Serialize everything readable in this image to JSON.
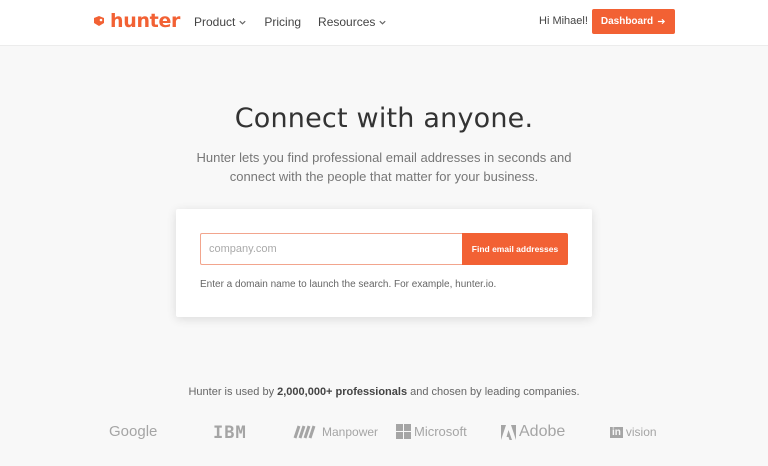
{
  "header": {
    "logo_text": "hunter",
    "nav": [
      {
        "label": "Product",
        "has_dropdown": true
      },
      {
        "label": "Pricing",
        "has_dropdown": false
      },
      {
        "label": "Resources",
        "has_dropdown": true
      }
    ],
    "greeting": "Hi Mihael!",
    "dashboard_button": "Dashboard",
    "dashboard_icon": "arrow-right-icon"
  },
  "hero": {
    "title": "Connect with anyone.",
    "subtitle": "Hunter lets you find professional email addresses in seconds and connect with the people that matter for your business."
  },
  "search": {
    "placeholder": "company.com",
    "value": "",
    "button_label": "Find email addresses",
    "hint": "Enter a domain name to launch the search. For example, hunter.io."
  },
  "proof": {
    "prefix": "Hunter is used by ",
    "highlight": "2,000,000+ professionals",
    "suffix": " and chosen by leading companies."
  },
  "brands": {
    "google": "Google",
    "ibm": "IBM",
    "manpower": "Manpower",
    "microsoft": "Microsoft",
    "adobe": "Adobe",
    "invision_a": "in",
    "invision_b": "vision"
  },
  "colors": {
    "accent": "#f26134",
    "background": "#f8f8f8",
    "brand_gray": "#a5a5a5"
  }
}
